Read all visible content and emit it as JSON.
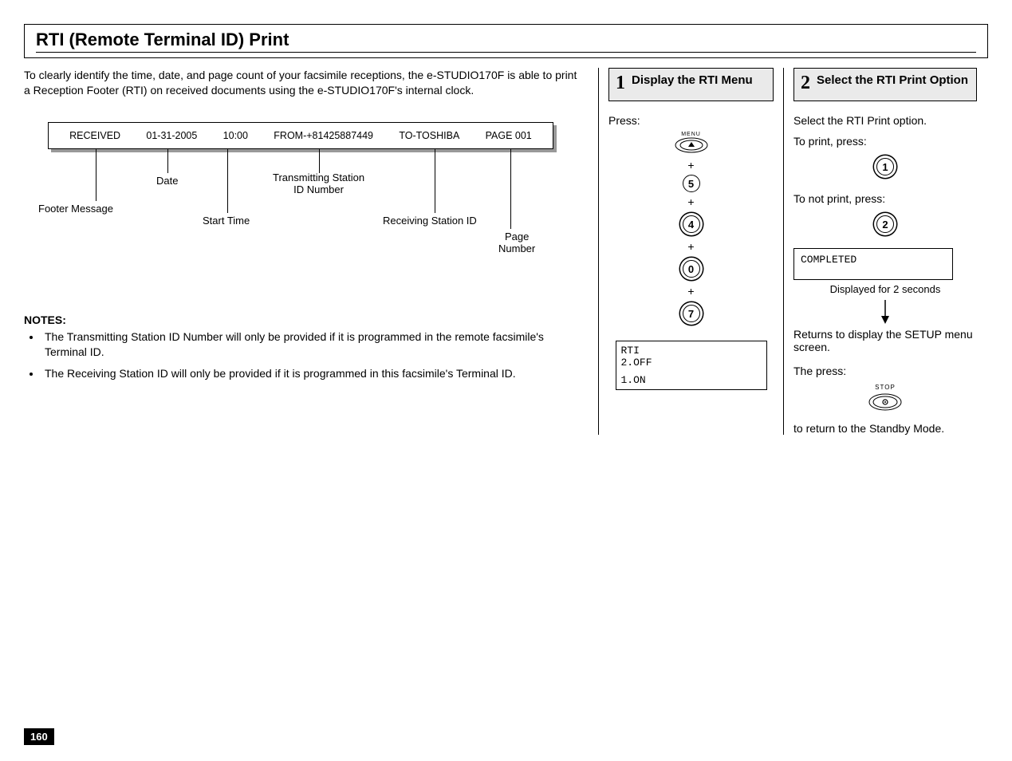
{
  "page": {
    "number": "160"
  },
  "header": {
    "title": "RTI (Remote Terminal ID) Print"
  },
  "intro": "To clearly identify the time, date, and page count of your facsimile receptions, the e-STUDIO170F is able to print a Reception Footer (RTI) on received documents using the e-STUDIO170F's internal clock.",
  "printout": {
    "fields": {
      "received": "RECEIVED",
      "date": "01-31-2005",
      "time": "10:00",
      "from": "FROM-+81425887449",
      "to": "TO-TOSHIBA",
      "page": "PAGE 001"
    },
    "labels": {
      "footer": "Footer Message",
      "date": "Date",
      "start": "Start Time",
      "txid": "Transmitting Station\nID Number",
      "rxid": "Receiving Station ID",
      "pagenum": "Page\nNumber"
    }
  },
  "notes": {
    "heading": "NOTES:",
    "items": [
      "The Transmitting Station ID Number will only be provided if it is programmed in the remote facsimile's Terminal ID.",
      "The Receiving Station ID will only be provided if it is programmed in this facsimile's Terminal ID."
    ]
  },
  "step1": {
    "num": "1",
    "title": "Display the RTI Menu",
    "press": "Press:",
    "menu_label": "MENU",
    "plus": "+",
    "keys": [
      "5",
      "4",
      "0",
      "7"
    ],
    "lcd": {
      "line1": "RTI",
      "line2": "2.OFF",
      "line3": "1.ON"
    }
  },
  "step2": {
    "num": "2",
    "title": "Select the RTI Print Option",
    "l1": "Select the RTI Print option.",
    "l2": "To print, press:",
    "key_print": "1",
    "l3": "To not print, press:",
    "key_noprint": "2",
    "completed": "COMPLETED",
    "disp2s": "Displayed for 2 seconds",
    "returns": "Returns to display the SETUP menu screen.",
    "thepress": "The press:",
    "stop_label": "STOP",
    "standby": "to return to the Standby Mode."
  }
}
